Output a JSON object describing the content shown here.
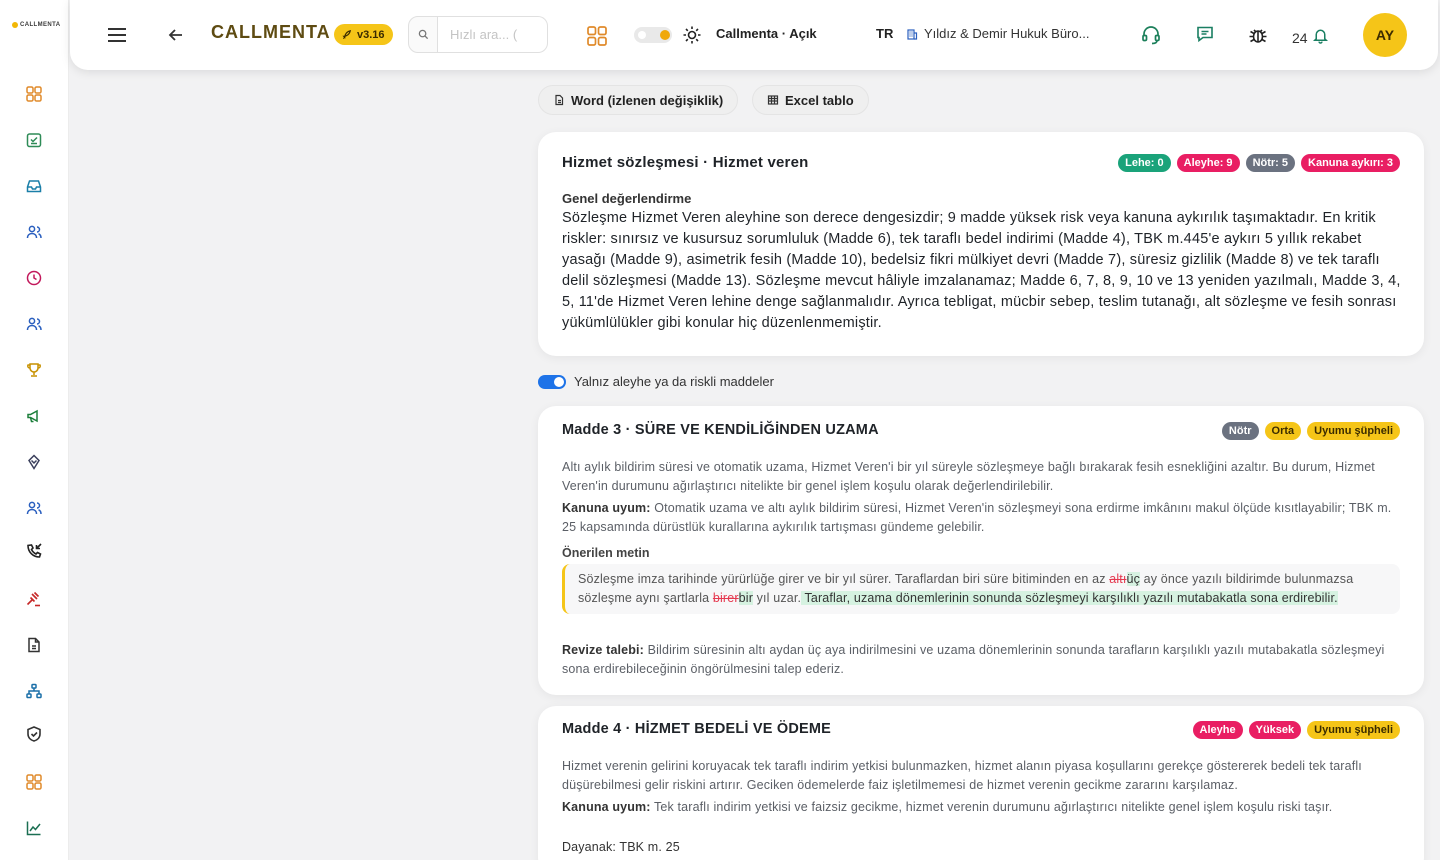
{
  "sidebar": {
    "brand": "CALLMENTA",
    "items": [
      "dashboard-icon",
      "calendar-check-icon",
      "inbox-icon",
      "users-icon",
      "clock-icon",
      "team-icon",
      "trophy-icon",
      "megaphone-icon",
      "handshake-icon",
      "contacts-icon",
      "phone-incoming-icon",
      "gavel-icon",
      "document-icon",
      "org-chart-icon",
      "shield-check-icon",
      "apps-icon",
      "analytics-icon"
    ]
  },
  "topbar": {
    "app_name": "CALLMENTA",
    "version": "v3.16",
    "search_placeholder": "Hızlı ara... (",
    "theme_label": "Callmenta · Açık",
    "lang": "TR",
    "org": "Yıldız & Demir Hukuk Büro...",
    "notif_count": "24",
    "avatar": "AY"
  },
  "actions": {
    "word": "Word (izlenen değişiklik)",
    "excel": "Excel tablo"
  },
  "summary": {
    "title": "Hizmet sözleşmesi · Hizmet veren",
    "badges": [
      "Lehe: 0",
      "Aleyhe: 9",
      "Nötr: 5",
      "Kanuna aykırı: 3"
    ],
    "label": "Genel değerlendirme",
    "text": "Sözleşme Hizmet Veren aleyhine son derece dengesizdir; 9 madde yüksek risk veya kanuna aykırılık taşımaktadır. En kritik riskler: sınırsız ve kusursuz sorumluluk (Madde 6), tek taraflı bedel indirimi (Madde 4), TBK m.445'e aykırı 5 yıllık rekabet yasağı (Madde 9), asimetrik fesih (Madde 10), bedelsiz fikri mülkiyet devri (Madde 7), süresiz gizlilik (Madde 8) ve tek taraflı delil sözleşmesi (Madde 13). Sözleşme mevcut hâliyle imzalanamaz; Madde 6, 7, 8, 9, 10 ve 13 yeniden yazılmalı, Madde 3, 4, 5, 11'de Hizmet Veren lehine denge sağlanmalıdır. Ayrıca tebligat, mücbir sebep, teslim tutanağı, alt sözleşme ve fesih sonrası yükümlülükler gibi konular hiç düzenlenmemiştir."
  },
  "filter": {
    "label": "Yalnız aleyhe ya da riskli maddeler",
    "on": true
  },
  "madde3": {
    "title": "Madde 3 · SÜRE VE KENDİLİĞİNDEN UZAMA",
    "badges": [
      "Nötr",
      "Orta",
      "Uyumu şüpheli"
    ],
    "desc": "Altı aylık bildirim süresi ve otomatik uzama, Hizmet Veren'i bir yıl süreyle sözleşmeye bağlı bırakarak fesih esnekliğini azaltır. Bu durum, Hizmet Veren'in durumunu ağırlaştırıcı nitelikte bir genel işlem koşulu olarak değerlendirilebilir.",
    "law_label": "Kanuna uyum:",
    "law": " Otomatik uzama ve altı aylık bildirim süresi, Hizmet Veren'in sözleşmeyi sona erdirme imkânını makul ölçüde kısıtlayabilir; TBK m. 25 kapsamında dürüstlük kurallarına aykırılık tartışması gündeme gelebilir.",
    "suggested_label": "Önerilen metin",
    "s1": "Sözleşme imza tarihinde yürürlüğe girer ve bir yıl sürer. Taraflardan biri süre bitiminden en az ",
    "s_del1": "altı",
    "s_ins1": "üç",
    "s2": " ay önce yazılı bildirimde bulunmazsa sözleşme aynı şartlarla ",
    "s_del2": "birer",
    "s_ins2": "bir",
    "s3": " yıl uzar.",
    "s_ins3": " Taraflar, uzama dönemlerinin sonunda sözleşmeyi karşılıklı yazılı mutabakatla sona erdirebilir.",
    "revise_label": "Revize talebi:",
    "revise": " Bildirim süresinin altı aydan üç aya indirilmesini ve uzama dönemlerinin sonunda tarafların karşılıklı yazılı mutabakatla sözleşmeyi sona erdirebileceğinin öngörülmesini talep ederiz."
  },
  "madde4": {
    "title": "Madde 4 · HİZMET BEDELİ VE ÖDEME",
    "badges": [
      "Aleyhe",
      "Yüksek",
      "Uyumu şüpheli"
    ],
    "desc": "Hizmet verenin gelirini koruyacak tek taraflı indirim yetkisi bulunmazken, hizmet alanın piyasa koşullarını gerekçe göstererek bedeli tek taraflı düşürebilmesi gelir riskini artırır. Geciken ödemelerde faiz işletilmemesi de hizmet verenin gecikme zararını karşılamaz.",
    "law_label": "Kanuna uyum:",
    "law": " Tek taraflı indirim yetkisi ve faizsiz gecikme, hizmet verenin durumunu ağırlaştırıcı nitelikte genel işlem koşulu riski taşır.",
    "basis": "Dayanak: TBK m. 25"
  }
}
